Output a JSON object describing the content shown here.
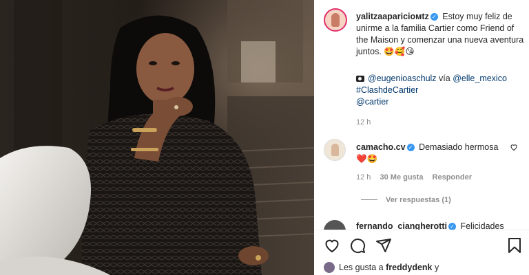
{
  "post": {
    "caption": {
      "username": "yalitzaaparicioмtz",
      "text": "Estoy muy feliz de unirme a la familia Cartier como Friend of the Maison y comenzar una nueva aventura juntos.",
      "emojis": "🤩🥰😘",
      "credit_handle": "@eugenioaschulz",
      "credit_via": "vía",
      "credit_mag": "@elle_mexico",
      "hashtag": "#ClashdeCartier",
      "mention": "@cartier",
      "time": "12 h"
    },
    "comments": [
      {
        "username": "camacho.cv",
        "text": "Demasiado hermosa",
        "emojis": "❤️🤩",
        "time": "12 h",
        "likes": "30 Me gusta",
        "reply": "Responder",
        "view_replies": "Ver respuestas (1)"
      },
      {
        "username": "fernando_ciangherotti",
        "text": "Felicidades"
      }
    ],
    "likes_text": "Les gusta a",
    "likes_user": "freddydenk",
    "likes_more": "y"
  },
  "icons": {
    "like": "heart-icon",
    "comment": "comment-icon",
    "share": "paper-plane-icon",
    "save": "bookmark-icon",
    "verified": "verified-badge-icon"
  },
  "colors": {
    "link": "#00376b",
    "verified": "#3897f0",
    "muted": "#8e8e8e"
  }
}
